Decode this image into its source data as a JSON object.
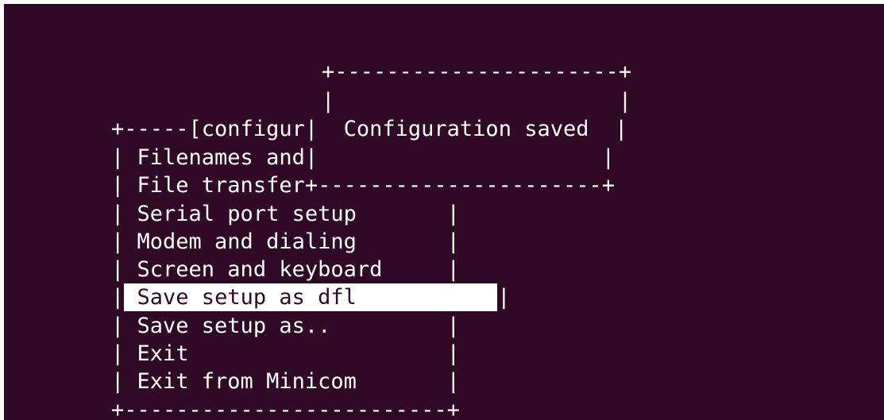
{
  "terminal": {
    "background": "#300a24",
    "foreground": "#ffffff",
    "lines": [
      "",
      "",
      "                      +----------------------+",
      "                      |                      |",
      "  +-----[configur|  Configuration saved  |",
      "  | Filenames and|                      |",
      "  | File transfer+----------------------+",
      "  | Serial port setup         |",
      "  | Modem and dialing         |",
      "  | Screen and keyboard       |",
      "  |",
      "  | Save setup as..           |",
      "  | Exit                      |",
      "  | Exit from Minicom         |",
      "  +-------------------------+"
    ]
  },
  "dialog": {
    "message": "Configuration saved"
  },
  "menu": {
    "title_fragment": "configur",
    "items": [
      {
        "label": "Filenames and",
        "selected": false
      },
      {
        "label": "File transfer",
        "selected": false
      },
      {
        "label": "Serial port setup",
        "selected": false
      },
      {
        "label": "Modem and dialing",
        "selected": false
      },
      {
        "label": "Screen and keyboard",
        "selected": false
      },
      {
        "label": "Save setup as dfl",
        "selected": true
      },
      {
        "label": "Save setup as..",
        "selected": false
      },
      {
        "label": "Exit",
        "selected": false
      },
      {
        "label": "Exit from Minicom",
        "selected": false
      }
    ]
  }
}
